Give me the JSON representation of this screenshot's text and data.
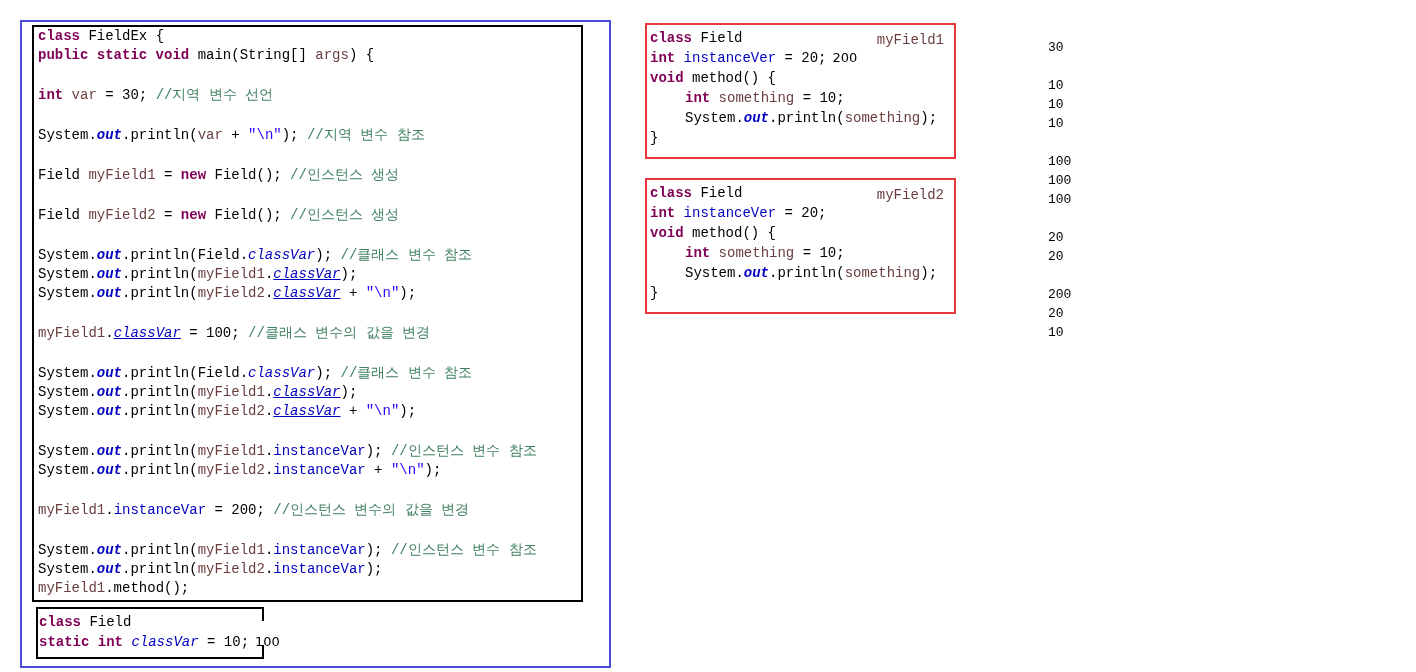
{
  "main_class": {
    "blocks": [
      {
        "lines": [
          {
            "tokens": [
              {
                "kind": "kw",
                "text": "class"
              },
              {
                "kind": "plain",
                "text": " FieldEx {"
              }
            ]
          },
          {
            "tokens": [
              {
                "kind": "kw",
                "text": "public static void"
              },
              {
                "kind": "plain",
                "text": " main(String[] "
              },
              {
                "kind": "local",
                "text": "args"
              },
              {
                "kind": "plain",
                "text": ") {"
              }
            ]
          }
        ]
      },
      {
        "lines": [
          {
            "tokens": [
              {
                "kind": "kw",
                "text": "int"
              },
              {
                "kind": "local",
                "text": " var"
              },
              {
                "kind": "plain",
                "text": " = 30; "
              },
              {
                "kind": "comment",
                "text": "//지역 변수 선언"
              }
            ]
          }
        ]
      },
      {
        "lines": [
          {
            "tokens": [
              {
                "kind": "plain",
                "text": "System."
              },
              {
                "kind": "out",
                "text": "out"
              },
              {
                "kind": "plain",
                "text": ".println("
              },
              {
                "kind": "local",
                "text": "var"
              },
              {
                "kind": "plain",
                "text": " + "
              },
              {
                "kind": "str",
                "text": "\"\\n\""
              },
              {
                "kind": "plain",
                "text": "); "
              },
              {
                "kind": "comment",
                "text": "//지역 변수 참조"
              }
            ]
          }
        ]
      },
      {
        "lines": [
          {
            "tokens": [
              {
                "kind": "plain",
                "text": "Field "
              },
              {
                "kind": "local",
                "text": "myField1"
              },
              {
                "kind": "plain",
                "text": " = "
              },
              {
                "kind": "kw",
                "text": "new"
              },
              {
                "kind": "plain",
                "text": " Field(); "
              },
              {
                "kind": "comment",
                "text": "//인스턴스 생성"
              }
            ]
          }
        ]
      },
      {
        "lines": [
          {
            "tokens": [
              {
                "kind": "plain",
                "text": "Field "
              },
              {
                "kind": "local",
                "text": "myField2"
              },
              {
                "kind": "plain",
                "text": " = "
              },
              {
                "kind": "kw",
                "text": "new"
              },
              {
                "kind": "plain",
                "text": " Field(); "
              },
              {
                "kind": "comment",
                "text": "//인스턴스 생성"
              }
            ]
          }
        ]
      },
      {
        "lines": [
          {
            "tokens": [
              {
                "kind": "plain",
                "text": "System."
              },
              {
                "kind": "out",
                "text": "out"
              },
              {
                "kind": "plain",
                "text": ".println(Field."
              },
              {
                "kind": "static",
                "text": "classVar"
              },
              {
                "kind": "plain",
                "text": "); "
              },
              {
                "kind": "comment",
                "text": "//클래스 변수 참조"
              }
            ]
          },
          {
            "tokens": [
              {
                "kind": "plain",
                "text": "System."
              },
              {
                "kind": "out",
                "text": "out"
              },
              {
                "kind": "plain",
                "text": ".println("
              },
              {
                "kind": "local",
                "text": "myField1"
              },
              {
                "kind": "plain",
                "text": "."
              },
              {
                "kind": "link",
                "text": "classVar"
              },
              {
                "kind": "plain",
                "text": ");"
              }
            ]
          },
          {
            "tokens": [
              {
                "kind": "plain",
                "text": "System."
              },
              {
                "kind": "out",
                "text": "out"
              },
              {
                "kind": "plain",
                "text": ".println("
              },
              {
                "kind": "local",
                "text": "myField2"
              },
              {
                "kind": "plain",
                "text": "."
              },
              {
                "kind": "link",
                "text": "classVar"
              },
              {
                "kind": "plain",
                "text": " + "
              },
              {
                "kind": "str",
                "text": "\"\\n\""
              },
              {
                "kind": "plain",
                "text": ");"
              }
            ]
          }
        ]
      },
      {
        "lines": [
          {
            "tokens": [
              {
                "kind": "local",
                "text": "myField1"
              },
              {
                "kind": "plain",
                "text": "."
              },
              {
                "kind": "link",
                "text": "classVar"
              },
              {
                "kind": "plain",
                "text": " = 100; "
              },
              {
                "kind": "comment",
                "text": "//클래스 변수의 값을 변경"
              }
            ]
          }
        ]
      },
      {
        "lines": [
          {
            "tokens": [
              {
                "kind": "plain",
                "text": "System."
              },
              {
                "kind": "out",
                "text": "out"
              },
              {
                "kind": "plain",
                "text": ".println(Field."
              },
              {
                "kind": "static",
                "text": "classVar"
              },
              {
                "kind": "plain",
                "text": "); "
              },
              {
                "kind": "comment",
                "text": "//클래스 변수 참조"
              }
            ]
          },
          {
            "tokens": [
              {
                "kind": "plain",
                "text": "System."
              },
              {
                "kind": "out",
                "text": "out"
              },
              {
                "kind": "plain",
                "text": ".println("
              },
              {
                "kind": "local",
                "text": "myField1"
              },
              {
                "kind": "plain",
                "text": "."
              },
              {
                "kind": "link",
                "text": "classVar"
              },
              {
                "kind": "plain",
                "text": ");"
              }
            ]
          },
          {
            "tokens": [
              {
                "kind": "plain",
                "text": "System."
              },
              {
                "kind": "out",
                "text": "out"
              },
              {
                "kind": "plain",
                "text": ".println("
              },
              {
                "kind": "local",
                "text": "myField2"
              },
              {
                "kind": "plain",
                "text": "."
              },
              {
                "kind": "link",
                "text": "classVar"
              },
              {
                "kind": "plain",
                "text": " + "
              },
              {
                "kind": "str",
                "text": "\"\\n\""
              },
              {
                "kind": "plain",
                "text": ");"
              }
            ]
          }
        ]
      },
      {
        "lines": [
          {
            "tokens": [
              {
                "kind": "plain",
                "text": "System."
              },
              {
                "kind": "out",
                "text": "out"
              },
              {
                "kind": "plain",
                "text": ".println("
              },
              {
                "kind": "local",
                "text": "myField1"
              },
              {
                "kind": "plain",
                "text": "."
              },
              {
                "kind": "field",
                "text": "instanceVar"
              },
              {
                "kind": "plain",
                "text": "); "
              },
              {
                "kind": "comment",
                "text": "//인스턴스 변수 참조"
              }
            ]
          },
          {
            "tokens": [
              {
                "kind": "plain",
                "text": "System."
              },
              {
                "kind": "out",
                "text": "out"
              },
              {
                "kind": "plain",
                "text": ".println("
              },
              {
                "kind": "local",
                "text": "myField2"
              },
              {
                "kind": "plain",
                "text": "."
              },
              {
                "kind": "field",
                "text": "instanceVar"
              },
              {
                "kind": "plain",
                "text": " + "
              },
              {
                "kind": "str",
                "text": "\"\\n\""
              },
              {
                "kind": "plain",
                "text": ");"
              }
            ]
          }
        ]
      },
      {
        "lines": [
          {
            "tokens": [
              {
                "kind": "local",
                "text": "myField1"
              },
              {
                "kind": "plain",
                "text": "."
              },
              {
                "kind": "field",
                "text": "instanceVar"
              },
              {
                "kind": "plain",
                "text": " = 200; "
              },
              {
                "kind": "comment",
                "text": "//인스턴스 변수의 값을 변경"
              }
            ]
          }
        ]
      },
      {
        "lines": [
          {
            "tokens": [
              {
                "kind": "plain",
                "text": "System."
              },
              {
                "kind": "out",
                "text": "out"
              },
              {
                "kind": "plain",
                "text": ".println("
              },
              {
                "kind": "local",
                "text": "myField1"
              },
              {
                "kind": "plain",
                "text": "."
              },
              {
                "kind": "field",
                "text": "instanceVar"
              },
              {
                "kind": "plain",
                "text": "); "
              },
              {
                "kind": "comment",
                "text": "//인스턴스 변수 참조"
              }
            ]
          },
          {
            "tokens": [
              {
                "kind": "plain",
                "text": "System."
              },
              {
                "kind": "out",
                "text": "out"
              },
              {
                "kind": "plain",
                "text": ".println("
              },
              {
                "kind": "local",
                "text": "myField2"
              },
              {
                "kind": "plain",
                "text": "."
              },
              {
                "kind": "field",
                "text": "instanceVar"
              },
              {
                "kind": "plain",
                "text": ");"
              }
            ]
          },
          {
            "tokens": [
              {
                "kind": "local",
                "text": "myField1"
              },
              {
                "kind": "plain",
                "text": ".method();"
              }
            ]
          }
        ]
      }
    ]
  },
  "field_class": {
    "lines": [
      {
        "tokens": [
          {
            "kind": "kw",
            "text": "class"
          },
          {
            "kind": "plain",
            "text": " Field"
          }
        ]
      },
      {
        "tokens": [
          {
            "kind": "kw",
            "text": "static int"
          },
          {
            "kind": "static",
            "text": " classVar"
          },
          {
            "kind": "plain",
            "text": " = 10;"
          },
          {
            "kind": "note",
            "text": "100"
          }
        ]
      }
    ]
  },
  "instances": [
    {
      "label": "myField1",
      "lines": [
        {
          "indented": false,
          "tokens": [
            {
              "kind": "kw",
              "text": "class"
            },
            {
              "kind": "plain",
              "text": " Field"
            }
          ]
        },
        {
          "indented": false,
          "tokens": [
            {
              "kind": "kw",
              "text": "int"
            },
            {
              "kind": "field",
              "text": " instanceVer"
            },
            {
              "kind": "plain",
              "text": " = 20;"
            },
            {
              "kind": "note",
              "text": "200"
            }
          ]
        },
        {
          "indented": false,
          "tokens": [
            {
              "kind": "kw",
              "text": "void"
            },
            {
              "kind": "plain",
              "text": " method() {"
            }
          ]
        },
        {
          "indented": true,
          "tokens": [
            {
              "kind": "kw",
              "text": "int"
            },
            {
              "kind": "local",
              "text": " something"
            },
            {
              "kind": "plain",
              "text": " = 10;"
            }
          ]
        },
        {
          "indented": true,
          "tokens": [
            {
              "kind": "plain",
              "text": "System."
            },
            {
              "kind": "out",
              "text": "out"
            },
            {
              "kind": "plain",
              "text": ".println("
            },
            {
              "kind": "local",
              "text": "something"
            },
            {
              "kind": "plain",
              "text": ");"
            }
          ]
        },
        {
          "indented": false,
          "tokens": [
            {
              "kind": "plain",
              "text": "}"
            }
          ]
        }
      ]
    },
    {
      "label": "myField2",
      "lines": [
        {
          "indented": false,
          "tokens": [
            {
              "kind": "kw",
              "text": "class"
            },
            {
              "kind": "plain",
              "text": " Field"
            }
          ]
        },
        {
          "indented": false,
          "tokens": [
            {
              "kind": "kw",
              "text": "int"
            },
            {
              "kind": "field",
              "text": " instanceVer"
            },
            {
              "kind": "plain",
              "text": " = 20;"
            }
          ]
        },
        {
          "indented": false,
          "tokens": [
            {
              "kind": "kw",
              "text": "void"
            },
            {
              "kind": "plain",
              "text": " method() {"
            }
          ]
        },
        {
          "indented": true,
          "tokens": [
            {
              "kind": "kw",
              "text": "int"
            },
            {
              "kind": "local",
              "text": " something"
            },
            {
              "kind": "plain",
              "text": " = 10;"
            }
          ]
        },
        {
          "indented": true,
          "tokens": [
            {
              "kind": "plain",
              "text": "System."
            },
            {
              "kind": "out",
              "text": "out"
            },
            {
              "kind": "plain",
              "text": ".println("
            },
            {
              "kind": "local",
              "text": "something"
            },
            {
              "kind": "plain",
              "text": ");"
            }
          ]
        },
        {
          "indented": false,
          "tokens": [
            {
              "kind": "plain",
              "text": "}"
            }
          ]
        }
      ]
    }
  ],
  "output": [
    {
      "lines": [
        "30"
      ]
    },
    {
      "lines": [
        "10",
        "10",
        "10"
      ]
    },
    {
      "lines": [
        "100",
        "100",
        "100"
      ]
    },
    {
      "lines": [
        "20",
        "20"
      ]
    },
    {
      "lines": [
        "200",
        "20",
        "10"
      ]
    }
  ]
}
